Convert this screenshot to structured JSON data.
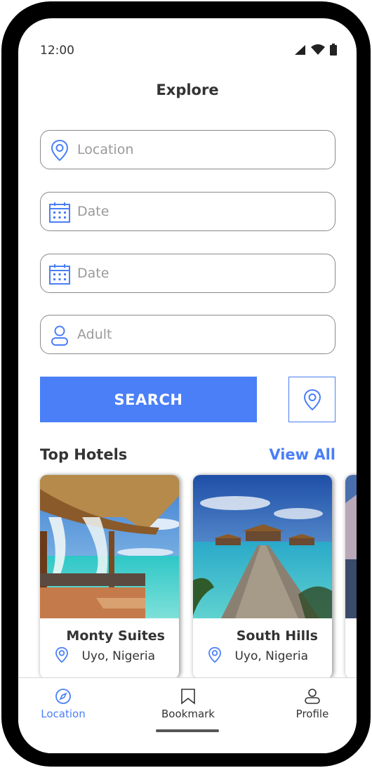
{
  "status_bar": {
    "time": "12:00"
  },
  "header": {
    "title": "Explore"
  },
  "form": {
    "location": {
      "placeholder": "Location",
      "value": ""
    },
    "date_from": {
      "placeholder": "Date",
      "value": ""
    },
    "date_to": {
      "placeholder": "Date",
      "value": ""
    },
    "guests": {
      "placeholder": "Adult",
      "value": ""
    },
    "search_label": "SEARCH"
  },
  "top_hotels": {
    "title": "Top Hotels",
    "view_all_label": "View All",
    "items": [
      {
        "name": "Monty Suites",
        "location": "Uyo, Nigeria"
      },
      {
        "name": "South Hills",
        "location": "Uyo, Nigeria"
      }
    ]
  },
  "nav": {
    "items": [
      {
        "label": "Location",
        "active": true
      },
      {
        "label": "Bookmark",
        "active": false
      },
      {
        "label": "Profile",
        "active": false
      }
    ]
  },
  "colors": {
    "accent": "#4a7ff7",
    "text": "#333333",
    "placeholder": "#9a9a9a"
  }
}
